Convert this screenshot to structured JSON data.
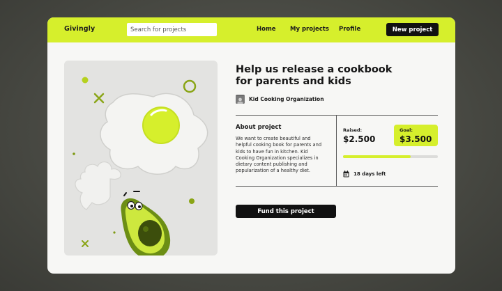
{
  "header": {
    "brand": "Givingly",
    "search_placeholder": "Search for projects",
    "nav": [
      "Home",
      "My projects",
      "Profile"
    ],
    "new_project_label": "New project"
  },
  "project": {
    "title": "Help us release a cookbook for parents and kids",
    "organization": "Kid Cooking Organization",
    "about_heading": "About project",
    "about_text": "We want to create beautiful and helpful cooking book for parents and kids to have fun in kitchen. Kid Cooking Organization specializes in dietary content publishing and popularization of a healthy diet.",
    "raised_label": "Raised:",
    "raised_value": "$2.500",
    "goal_label": "Goal:",
    "goal_value": "$3.500",
    "progress_fraction": 0.71,
    "days_left": "18 days left",
    "fund_label": "Fund this project"
  },
  "icons": {
    "calendar": "calendar-icon",
    "illustration": [
      "fried-egg",
      "avocado",
      "cloud-shape",
      "sparkle-decorations"
    ]
  },
  "colors": {
    "accent": "#d6ef2c",
    "dark": "#111111",
    "card": "#f7f7f5",
    "illustration_bg": "#e3e3e1"
  }
}
